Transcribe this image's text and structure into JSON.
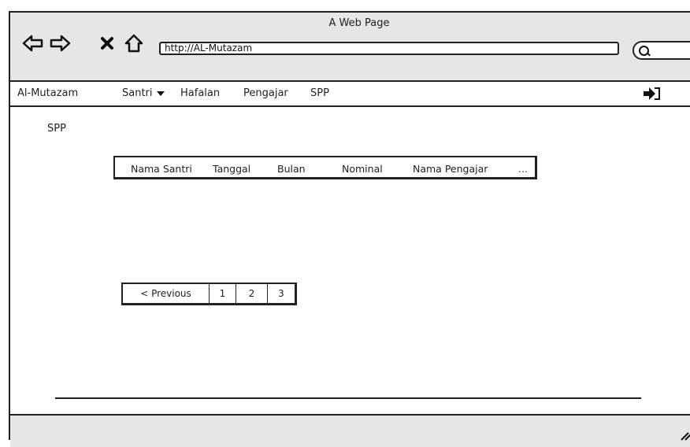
{
  "window": {
    "title": "A Web Page",
    "url": "http://AL-Mutazam"
  },
  "nav": {
    "back_icon": "back-arrow-icon",
    "forward_icon": "forward-arrow-icon",
    "stop_icon": "stop-x-icon",
    "home_icon": "home-icon"
  },
  "menu": {
    "brand": "Al-Mutazam",
    "items": [
      "Santri",
      "Hafalan",
      "Pengajar",
      "SPP"
    ],
    "logout_icon": "sign-out-icon"
  },
  "main": {
    "page_title": "SPP",
    "table": {
      "columns": [
        "Nama Santri",
        "Tanggal",
        "Bulan",
        "Nominal",
        "Nama Pengajar",
        "..."
      ]
    },
    "pagination": {
      "previous_label": "< Previous",
      "pages": [
        "1",
        "2",
        "3"
      ]
    }
  }
}
